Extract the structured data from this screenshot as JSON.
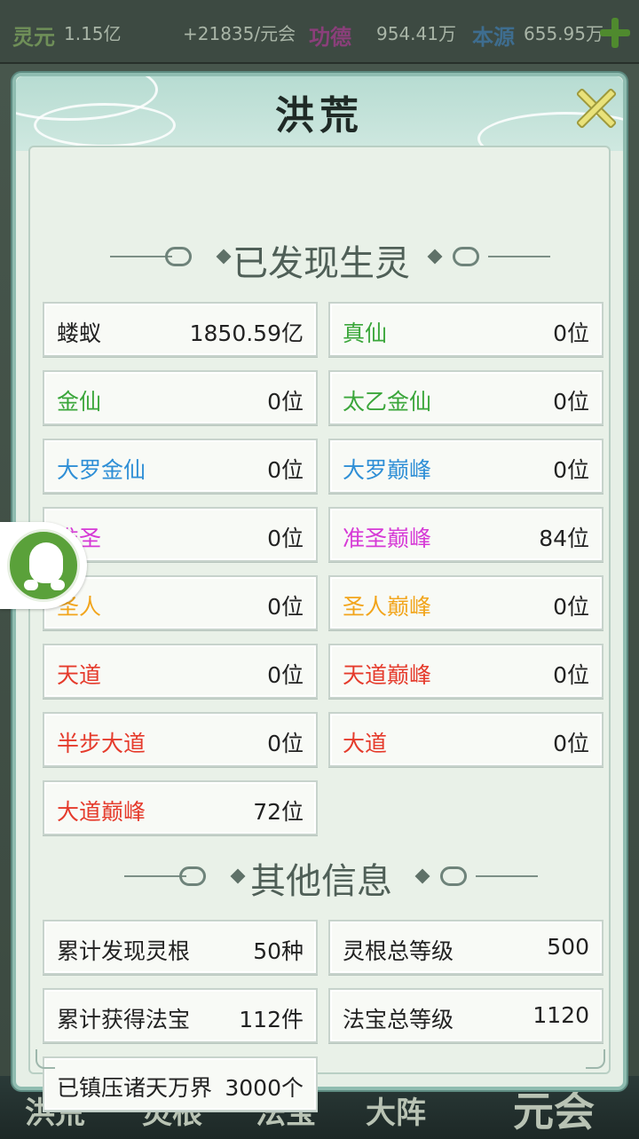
{
  "topbar": {
    "lingyuan_label": "灵元",
    "lingyuan_value": "1.15亿",
    "rate": "+21835/元会",
    "gongde_label": "功德",
    "gongde_value": "954.41万",
    "benyuan_label": "本源",
    "benyuan_value": "655.95万"
  },
  "dialog": {
    "title": "洪荒"
  },
  "sections": {
    "creatures_title": "已发现生灵",
    "other_title": "其他信息"
  },
  "creatures": [
    {
      "name": "蝼蚁",
      "value": "1850.59亿",
      "color": "#222222"
    },
    {
      "name": "真仙",
      "value": "0位",
      "color": "#3aa63a"
    },
    {
      "name": "金仙",
      "value": "0位",
      "color": "#3aa63a"
    },
    {
      "name": "太乙金仙",
      "value": "0位",
      "color": "#3aa63a"
    },
    {
      "name": "大罗金仙",
      "value": "0位",
      "color": "#2f8fd6"
    },
    {
      "name": "大罗巅峰",
      "value": "0位",
      "color": "#2f8fd6"
    },
    {
      "name": "准圣",
      "value": "0位",
      "color": "#d63ad6"
    },
    {
      "name": "准圣巅峰",
      "value": "84位",
      "color": "#d63ad6"
    },
    {
      "name": "圣人",
      "value": "0位",
      "color": "#f2a51c"
    },
    {
      "name": "圣人巅峰",
      "value": "0位",
      "color": "#f2a51c"
    },
    {
      "name": "天道",
      "value": "0位",
      "color": "#e53b2c"
    },
    {
      "name": "天道巅峰",
      "value": "0位",
      "color": "#e53b2c"
    },
    {
      "name": "半步大道",
      "value": "0位",
      "color": "#e53b2c"
    },
    {
      "name": "大道",
      "value": "0位",
      "color": "#e53b2c"
    },
    {
      "name": "大道巅峰",
      "value": "72位",
      "color": "#e53b2c"
    }
  ],
  "other": [
    {
      "name": "累计发现灵根",
      "value": "50种"
    },
    {
      "name": "灵根总等级",
      "value": "500"
    },
    {
      "name": "累计获得法宝",
      "value": "112件"
    },
    {
      "name": "法宝总等级",
      "value": "1120"
    },
    {
      "name": "已镇压诸天万界",
      "value": "3000个"
    }
  ],
  "bottomnav": {
    "items": [
      "洪荒",
      "灵根",
      "法宝",
      "大阵",
      "元会"
    ]
  },
  "icons": {
    "close": "close-icon",
    "plus": "plus-icon",
    "float": "qq-icon"
  }
}
